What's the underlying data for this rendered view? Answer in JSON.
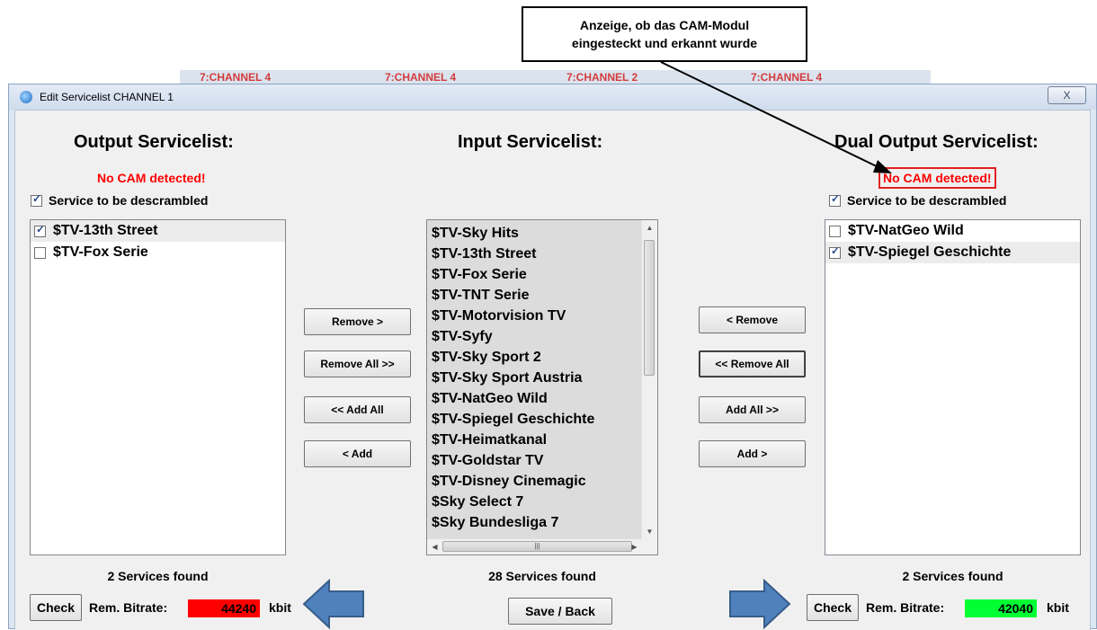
{
  "annotation": {
    "line1": "Anzeige, ob das CAM-Modul",
    "line2": "eingesteckt und erkannt wurde"
  },
  "background_tabs": [
    "7:CHANNEL 4",
    "7:CHANNEL 4",
    "7:CHANNEL 2",
    "7:CHANNEL 4"
  ],
  "window": {
    "title": "Edit Servicelist CHANNEL 1",
    "close_label": "X"
  },
  "left": {
    "heading": "Output Servicelist:",
    "cam_status": "No CAM detected!",
    "descramble_label": "Service to be descrambled",
    "descramble_checked": true,
    "services": [
      {
        "name": "$TV-13th Street",
        "checked": true
      },
      {
        "name": "$TV-Fox Serie",
        "checked": false
      }
    ],
    "count_text": "2 Services found",
    "check_label": "Check",
    "bitrate_label": "Rem. Bitrate:",
    "bitrate_value": "44240",
    "bitrate_color": "#ff0000",
    "unit": "kbit"
  },
  "middle": {
    "heading": "Input Servicelist:",
    "services": [
      "$TV-Sky Hits",
      "$TV-13th Street",
      "$TV-Fox Serie",
      "$TV-TNT Serie",
      "$TV-Motorvision TV",
      "$TV-Syfy",
      "$TV-Sky Sport 2",
      "$TV-Sky Sport Austria",
      "$TV-NatGeo Wild",
      "$TV-Spiegel Geschichte",
      "$TV-Heimatkanal",
      "$TV-Goldstar TV",
      "$TV-Disney Cinemagic",
      "$Sky Select 7",
      "$Sky Bundesliga 7"
    ],
    "count_text": "28 Services found",
    "save_label": "Save / Back"
  },
  "left_buttons": [
    "Remove  >",
    "Remove All  >>",
    "<<  Add All",
    "<  Add"
  ],
  "right_buttons": [
    "<  Remove",
    "<<  Remove All",
    "Add All  >>",
    "Add  >"
  ],
  "right": {
    "heading": "Dual Output Servicelist:",
    "cam_status": "No CAM detected!",
    "descramble_label": "Service to be descrambled",
    "descramble_checked": true,
    "services": [
      {
        "name": "$TV-NatGeo Wild",
        "checked": false
      },
      {
        "name": "$TV-Spiegel Geschichte",
        "checked": true
      }
    ],
    "count_text": "2 Services found",
    "check_label": "Check",
    "bitrate_label": "Rem. Bitrate:",
    "bitrate_value": "42040",
    "bitrate_color": "#00ff33",
    "unit": "kbit"
  },
  "colors": {
    "cam_warning": "#ff0000",
    "arrow_fill": "#4f81bd",
    "arrow_stroke": "#385d8a"
  },
  "icons": [
    "globe-icon",
    "checkbox-icon",
    "scroll-up-arrow-icon",
    "scroll-down-arrow-icon",
    "scroll-left-arrow-icon",
    "scroll-right-arrow-icon",
    "big-left-arrow-icon",
    "big-right-arrow-icon"
  ]
}
